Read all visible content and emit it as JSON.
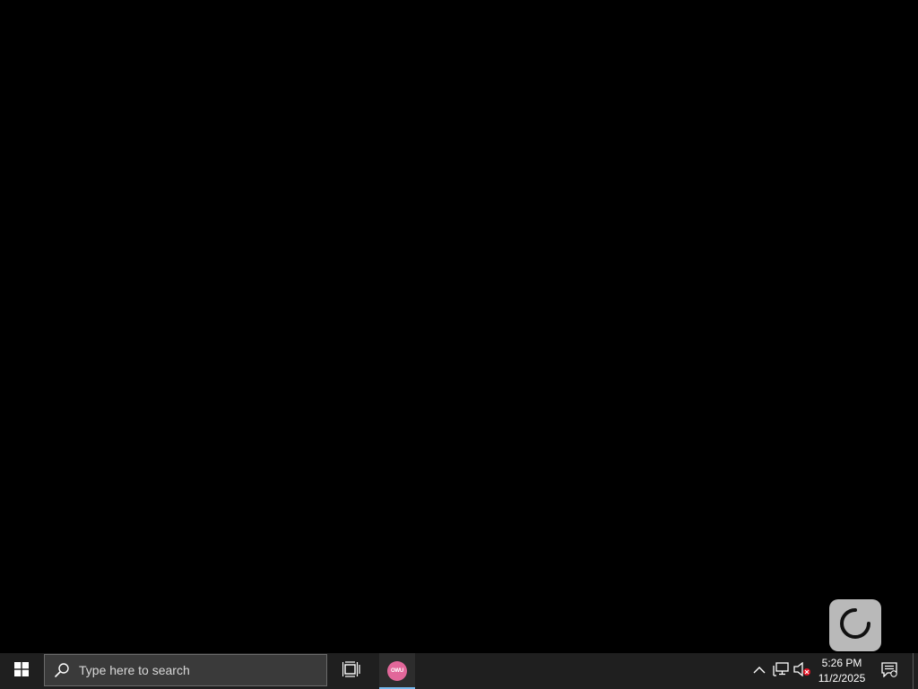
{
  "taskbar": {
    "search": {
      "placeholder": "Type here to search"
    },
    "app": {
      "icon_text": "OWU",
      "icon_color": "#e2679a",
      "active_underline_color": "#76b9ed"
    },
    "clock": {
      "time": "5:26 PM",
      "date": "11/2/2025"
    },
    "icons": {
      "start": "windows-logo-icon",
      "search": "search-icon",
      "task_view": "task-view-icon",
      "chevron": "chevron-up-icon",
      "network": "network-icon",
      "volume": "volume-muted-icon",
      "notification": "notification-icon"
    }
  },
  "overlay": {
    "icon": "loading-spinner-icon",
    "background": "#b9b9b9"
  }
}
